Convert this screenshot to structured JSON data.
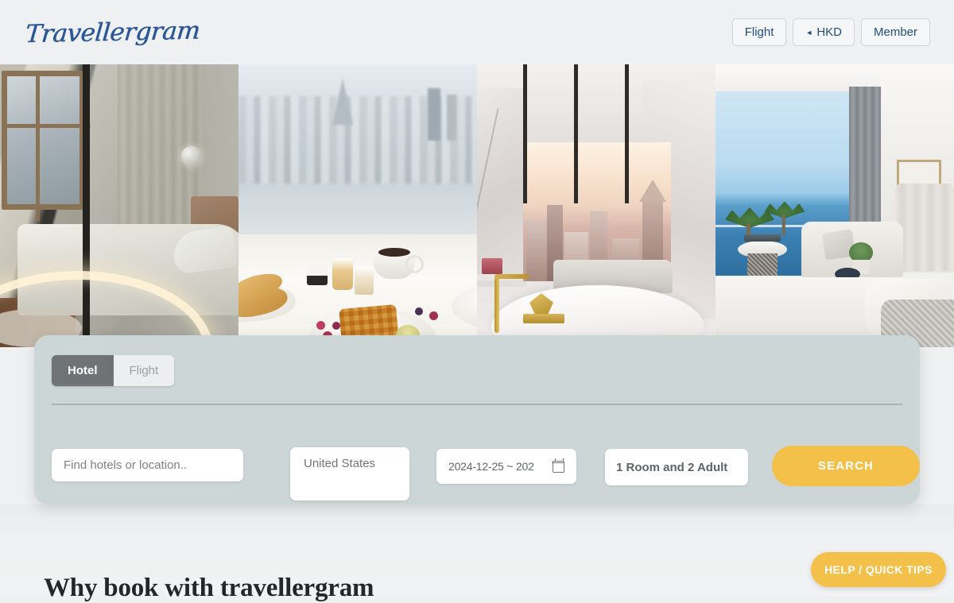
{
  "header": {
    "logo": "Travellergram",
    "nav": [
      {
        "label": "Flight",
        "icon": ""
      },
      {
        "label": "HKD",
        "icon": "◄"
      },
      {
        "label": "Member",
        "icon": ""
      }
    ]
  },
  "hero": {
    "images": [
      {
        "alt": "hotel-bedroom-with-ring-light"
      },
      {
        "alt": "breakfast-tray-with-city-view"
      },
      {
        "alt": "marble-bathroom-with-skyline"
      },
      {
        "alt": "ocean-view-suite-living-room"
      }
    ]
  },
  "search": {
    "tabs": [
      {
        "label": "Hotel",
        "active": true
      },
      {
        "label": "Flight",
        "active": false
      }
    ],
    "destination": {
      "placeholder": "Find hotels or location..",
      "value": ""
    },
    "country": {
      "value": "United States"
    },
    "dates": {
      "value": "2024-12-25 ~ 202",
      "icon": "calendar-icon"
    },
    "occupancy": {
      "value": "1 Room and 2 Adult"
    },
    "search_button": "SEARCH",
    "accent_color": "#f3c04a",
    "panel_color": "#ccd6d6"
  },
  "content": {
    "section_heading": "Why book with travellergram"
  },
  "help": {
    "label": "HELP / QUICK TIPS"
  }
}
